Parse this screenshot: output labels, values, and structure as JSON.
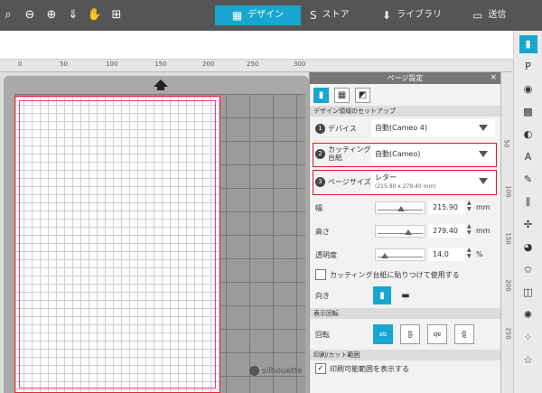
{
  "toolbar": {
    "tools": [
      {
        "name": "zoom-icon",
        "glyph": "🔍"
      },
      {
        "name": "zoom-out-icon",
        "glyph": "⊖"
      },
      {
        "name": "zoom-fit-icon",
        "glyph": "⊕"
      },
      {
        "name": "move-down-icon",
        "glyph": "⇓"
      },
      {
        "name": "pan-hand-icon",
        "glyph": "✋"
      },
      {
        "name": "fit-page-icon",
        "glyph": "⊞"
      }
    ]
  },
  "tabs": [
    {
      "label": "デザイン",
      "icon": "▦",
      "active": true
    },
    {
      "label": "ストア",
      "icon": "S",
      "active": false
    },
    {
      "label": "ライブラリ",
      "icon": "⬇",
      "active": false
    },
    {
      "label": "送信",
      "icon": "▭",
      "active": false
    }
  ],
  "ruler": {
    "top": [
      "0",
      "50",
      "100",
      "150",
      "200",
      "250",
      "300"
    ],
    "right": [
      "50",
      "100",
      "150",
      "200",
      "250"
    ]
  },
  "panel": {
    "title": "ページ設定",
    "close": "×",
    "section_setup": "デザイン領域のセットアップ",
    "device": {
      "num": "1",
      "label": "デバイス",
      "value": "自動(Cameo 4)"
    },
    "mat": {
      "num": "2",
      "label": "カッティング用台紙",
      "value": "自動(Cameo)"
    },
    "page_size": {
      "num": "3",
      "label": "ページサイズ",
      "value": "レター",
      "sub": "(215.90 x 279.40 mm)"
    },
    "width": {
      "label": "幅",
      "value": "215.90",
      "unit": "mm"
    },
    "height": {
      "label": "高さ",
      "value": "279.40",
      "unit": "mm"
    },
    "transparency": {
      "label": "透明度",
      "value": "14.0",
      "unit": "%"
    },
    "stick_to_mat": "カッティング台紙に貼りつけて使用する",
    "orientation_label": "向き",
    "section_rotate": "表示回転",
    "rotate_label": "回転",
    "rotate_options": [
      "ab",
      "ab",
      "ab",
      "ab"
    ],
    "section_print": "印刷/カット範囲",
    "show_print_area": "印刷可能範囲を表示する"
  },
  "watermark": "silhouette",
  "sidebar_icons": [
    "page-setup-icon",
    "pixscan-icon",
    "palette-icon",
    "fill-icon",
    "half-circle-icon",
    "text-icon",
    "sketch-icon",
    "align-icon",
    "replicate-icon",
    "modify-icon",
    "offset-icon",
    "trace-icon",
    "transform-icon",
    "dots-icon",
    "star-icon"
  ],
  "colors": {
    "accent": "#17a6cf",
    "highlight": "#d8202c",
    "topbar": "#555555"
  }
}
